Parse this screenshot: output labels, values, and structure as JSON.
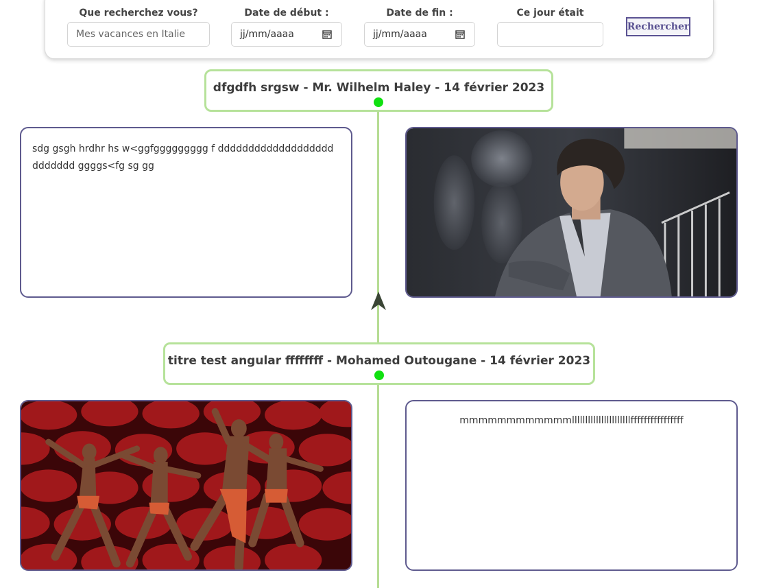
{
  "search": {
    "query_label": "Que recherchez vous?",
    "query_placeholder": "Mes vacances en Italie",
    "start_label": "Date de début :",
    "start_value": "jj/mm/aaaa",
    "end_label": "Date de fin :",
    "end_value": "jj/mm/aaaa",
    "weekday_label": "Ce jour était",
    "weekday_value": "",
    "button_label": "Rechercher"
  },
  "timeline": {
    "line_color": "#b6dc93",
    "dot_color": "#10e010",
    "entries": [
      {
        "heading": "dfgdfh srgsw - Mr. Wilhelm Haley - 14 février 2023",
        "text": "sdg gsgh hrdhr hs w<ggfggggggggg f ddddddddddddddddddd ddddddd ggggs<fg sg gg",
        "image": "portrait-man-in-suit-photo"
      },
      {
        "heading": "titre test angular ffffffff - Mohamed Outougane - 14 février 2023",
        "text": "mmmmmmmmmmmmllllllllllllllllllllllffffffffffffffff",
        "image": "dancers-red-background-photo"
      }
    ]
  }
}
